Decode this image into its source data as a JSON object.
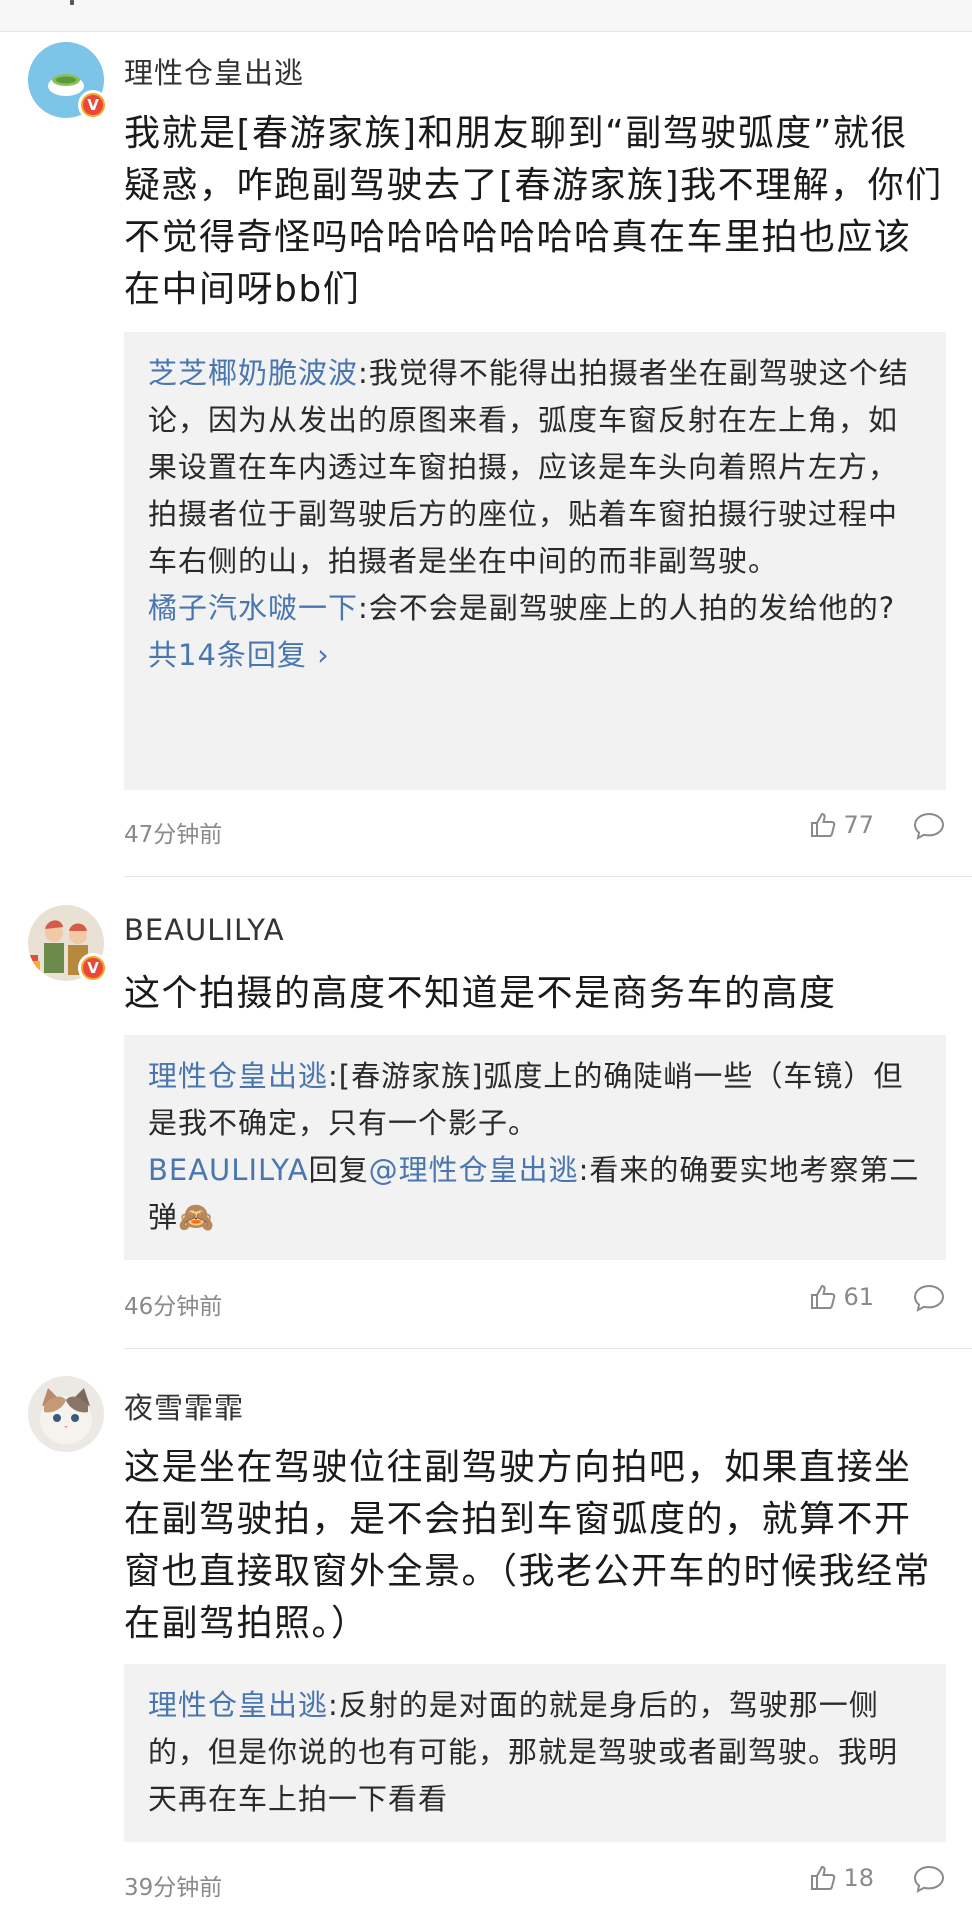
{
  "comments": [
    {
      "username": "理性仓皇出逃",
      "verified": true,
      "text": "我就是[春游家族]和朋友聊到“副驾驶弧度”就很疑惑，咋跑副驾驶去了[春游家族]我不理解，你们不觉得奇怪吗哈哈哈哈哈哈哈真在车里拍也应该在中间呀bb们",
      "replies": [
        {
          "nick": "芝芝椰奶脆波波",
          "sep": ":",
          "text": "我觉得不能得出拍摄者坐在副驾驶这个结论，因为从发出的原图来看，弧度车窗反射在左上角，如果设置在车内透过车窗拍摄，应该是车头向着照片左方，拍摄者位于副驾驶后方的座位，贴着车窗拍摄行驶过程中车右侧的山，拍摄者是坐在中间的而非副驾驶。"
        },
        {
          "nick": "橘子汽水啵一下",
          "sep": ":",
          "text": "会不会是副驾驶座上的人拍的发给他的?"
        }
      ],
      "more_replies": "共14条回复 ›",
      "time": "47分钟前",
      "likes": "77"
    },
    {
      "username": "BEAULILYA",
      "verified": true,
      "text": "这个拍摄的高度不知道是不是商务车的高度",
      "replies": [
        {
          "nick": "理性仓皇出逃",
          "sep": ":",
          "text": "[春游家族]弧度上的确陡峭一些（车镜）但是我不确定，只有一个影子。"
        },
        {
          "nick": "BEAULILYA",
          "mid": "回复",
          "mention": "@理性仓皇出逃",
          "sep": ":",
          "text": "看来的确要实地考察第二弹🙈"
        }
      ],
      "time": "46分钟前",
      "likes": "61"
    },
    {
      "username": "夜雪霏霏",
      "verified": false,
      "text": "这是坐在驾驶位往副驾驶方向拍吧，如果直接坐在副驾驶拍，是不会拍到车窗弧度的，就算不开窗也直接取窗外全景。（我老公开车的时候我经常在副驾拍照。）",
      "replies": [
        {
          "nick": "理性仓皇出逃",
          "sep": ":",
          "text": "反射的是对面的就是身后的，驾驶那一侧的，但是你说的也有可能，那就是驾驶或者副驾驶。我明天再在车上拍一下看看"
        }
      ],
      "time": "39分钟前",
      "likes": "18"
    }
  ]
}
